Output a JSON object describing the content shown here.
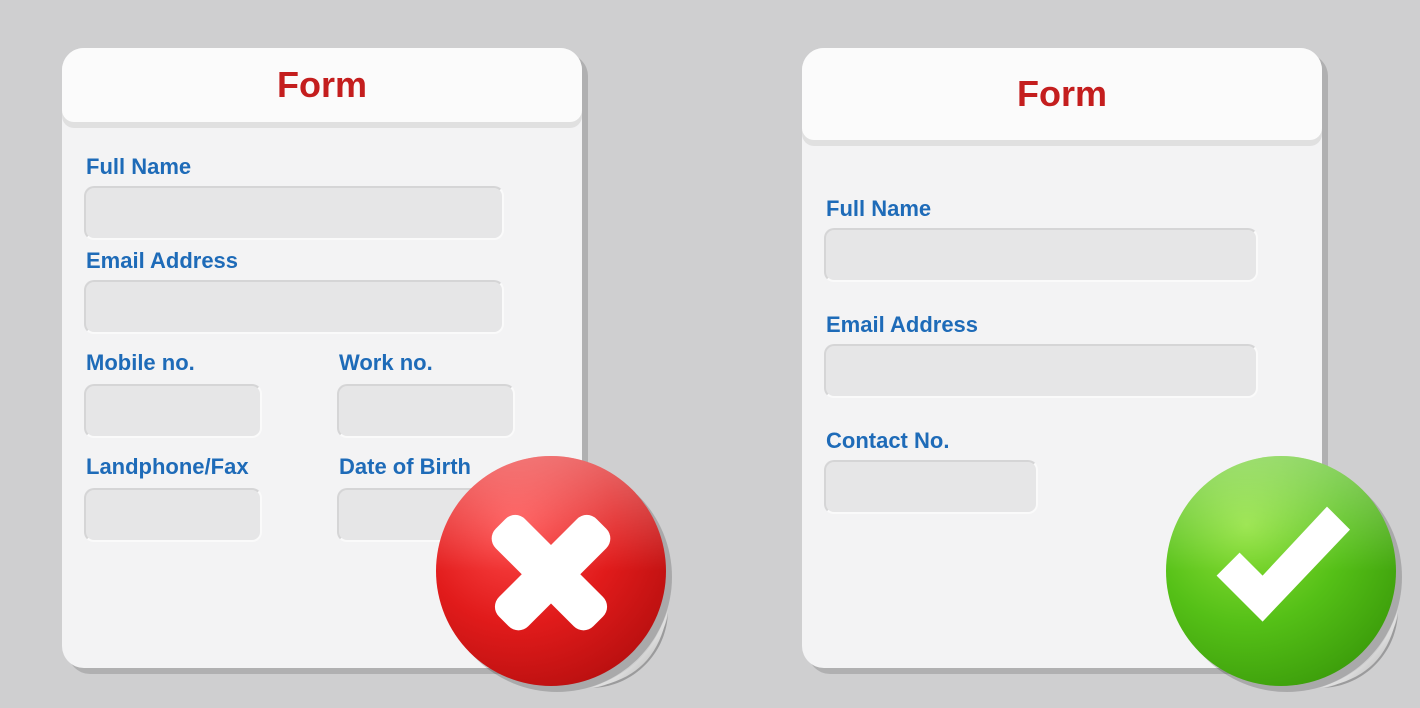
{
  "colors": {
    "header_text": "#c41e1e",
    "label_text": "#1e6bb8",
    "wrong_badge": "#d11a1a",
    "right_badge": "#55c017"
  },
  "form_bad": {
    "title": "Form",
    "verdict": "wrong",
    "fields": {
      "full_name": "Full Name",
      "email": "Email Address",
      "mobile": "Mobile no.",
      "work": "Work no.",
      "landphone": "Landphone/Fax",
      "dob": "Date of Birth"
    }
  },
  "form_good": {
    "title": "Form",
    "verdict": "correct",
    "fields": {
      "full_name": "Full Name",
      "email": "Email Address",
      "contact": "Contact No."
    }
  }
}
